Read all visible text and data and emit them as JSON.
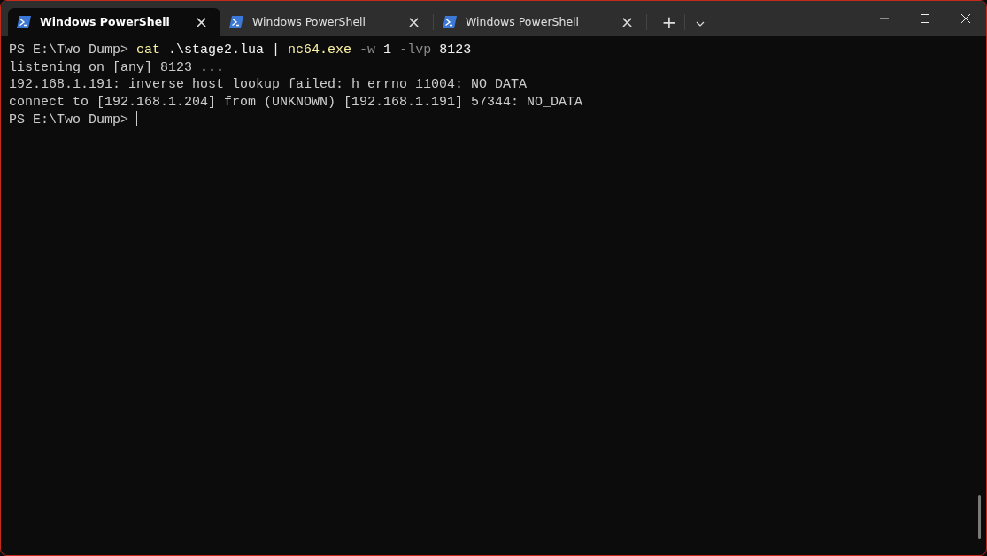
{
  "tabs": [
    {
      "title": "Windows PowerShell",
      "selected": true,
      "close": "×"
    },
    {
      "title": "Windows PowerShell",
      "selected": false,
      "close": "×"
    },
    {
      "title": "Windows PowerShell",
      "selected": false,
      "close": "×"
    }
  ],
  "new_tab": "+",
  "terminal": {
    "lines": [
      {
        "segments": [
          {
            "kind": "prompt",
            "text": "PS E:\\Two Dump> "
          },
          {
            "kind": "command",
            "text": "cat"
          },
          {
            "kind": "plain",
            "text": " .\\stage2.lua | "
          },
          {
            "kind": "command",
            "text": "nc64.exe"
          },
          {
            "kind": "param",
            "text": " -w"
          },
          {
            "kind": "plain",
            "text": " 1 "
          },
          {
            "kind": "param",
            "text": "-lvp"
          },
          {
            "kind": "plain",
            "text": " 8123"
          }
        ]
      },
      {
        "segments": [
          {
            "kind": "output",
            "text": "listening on [any] 8123 ..."
          }
        ]
      },
      {
        "segments": [
          {
            "kind": "output",
            "text": "192.168.1.191: inverse host lookup failed: h_errno 11004: NO_DATA"
          }
        ]
      },
      {
        "segments": [
          {
            "kind": "output",
            "text": "connect to [192.168.1.204] from (UNKNOWN) [192.168.1.191] 57344: NO_DATA"
          }
        ]
      },
      {
        "segments": [
          {
            "kind": "prompt",
            "text": "PS E:\\Two Dump> "
          }
        ],
        "cursor": true
      }
    ]
  }
}
